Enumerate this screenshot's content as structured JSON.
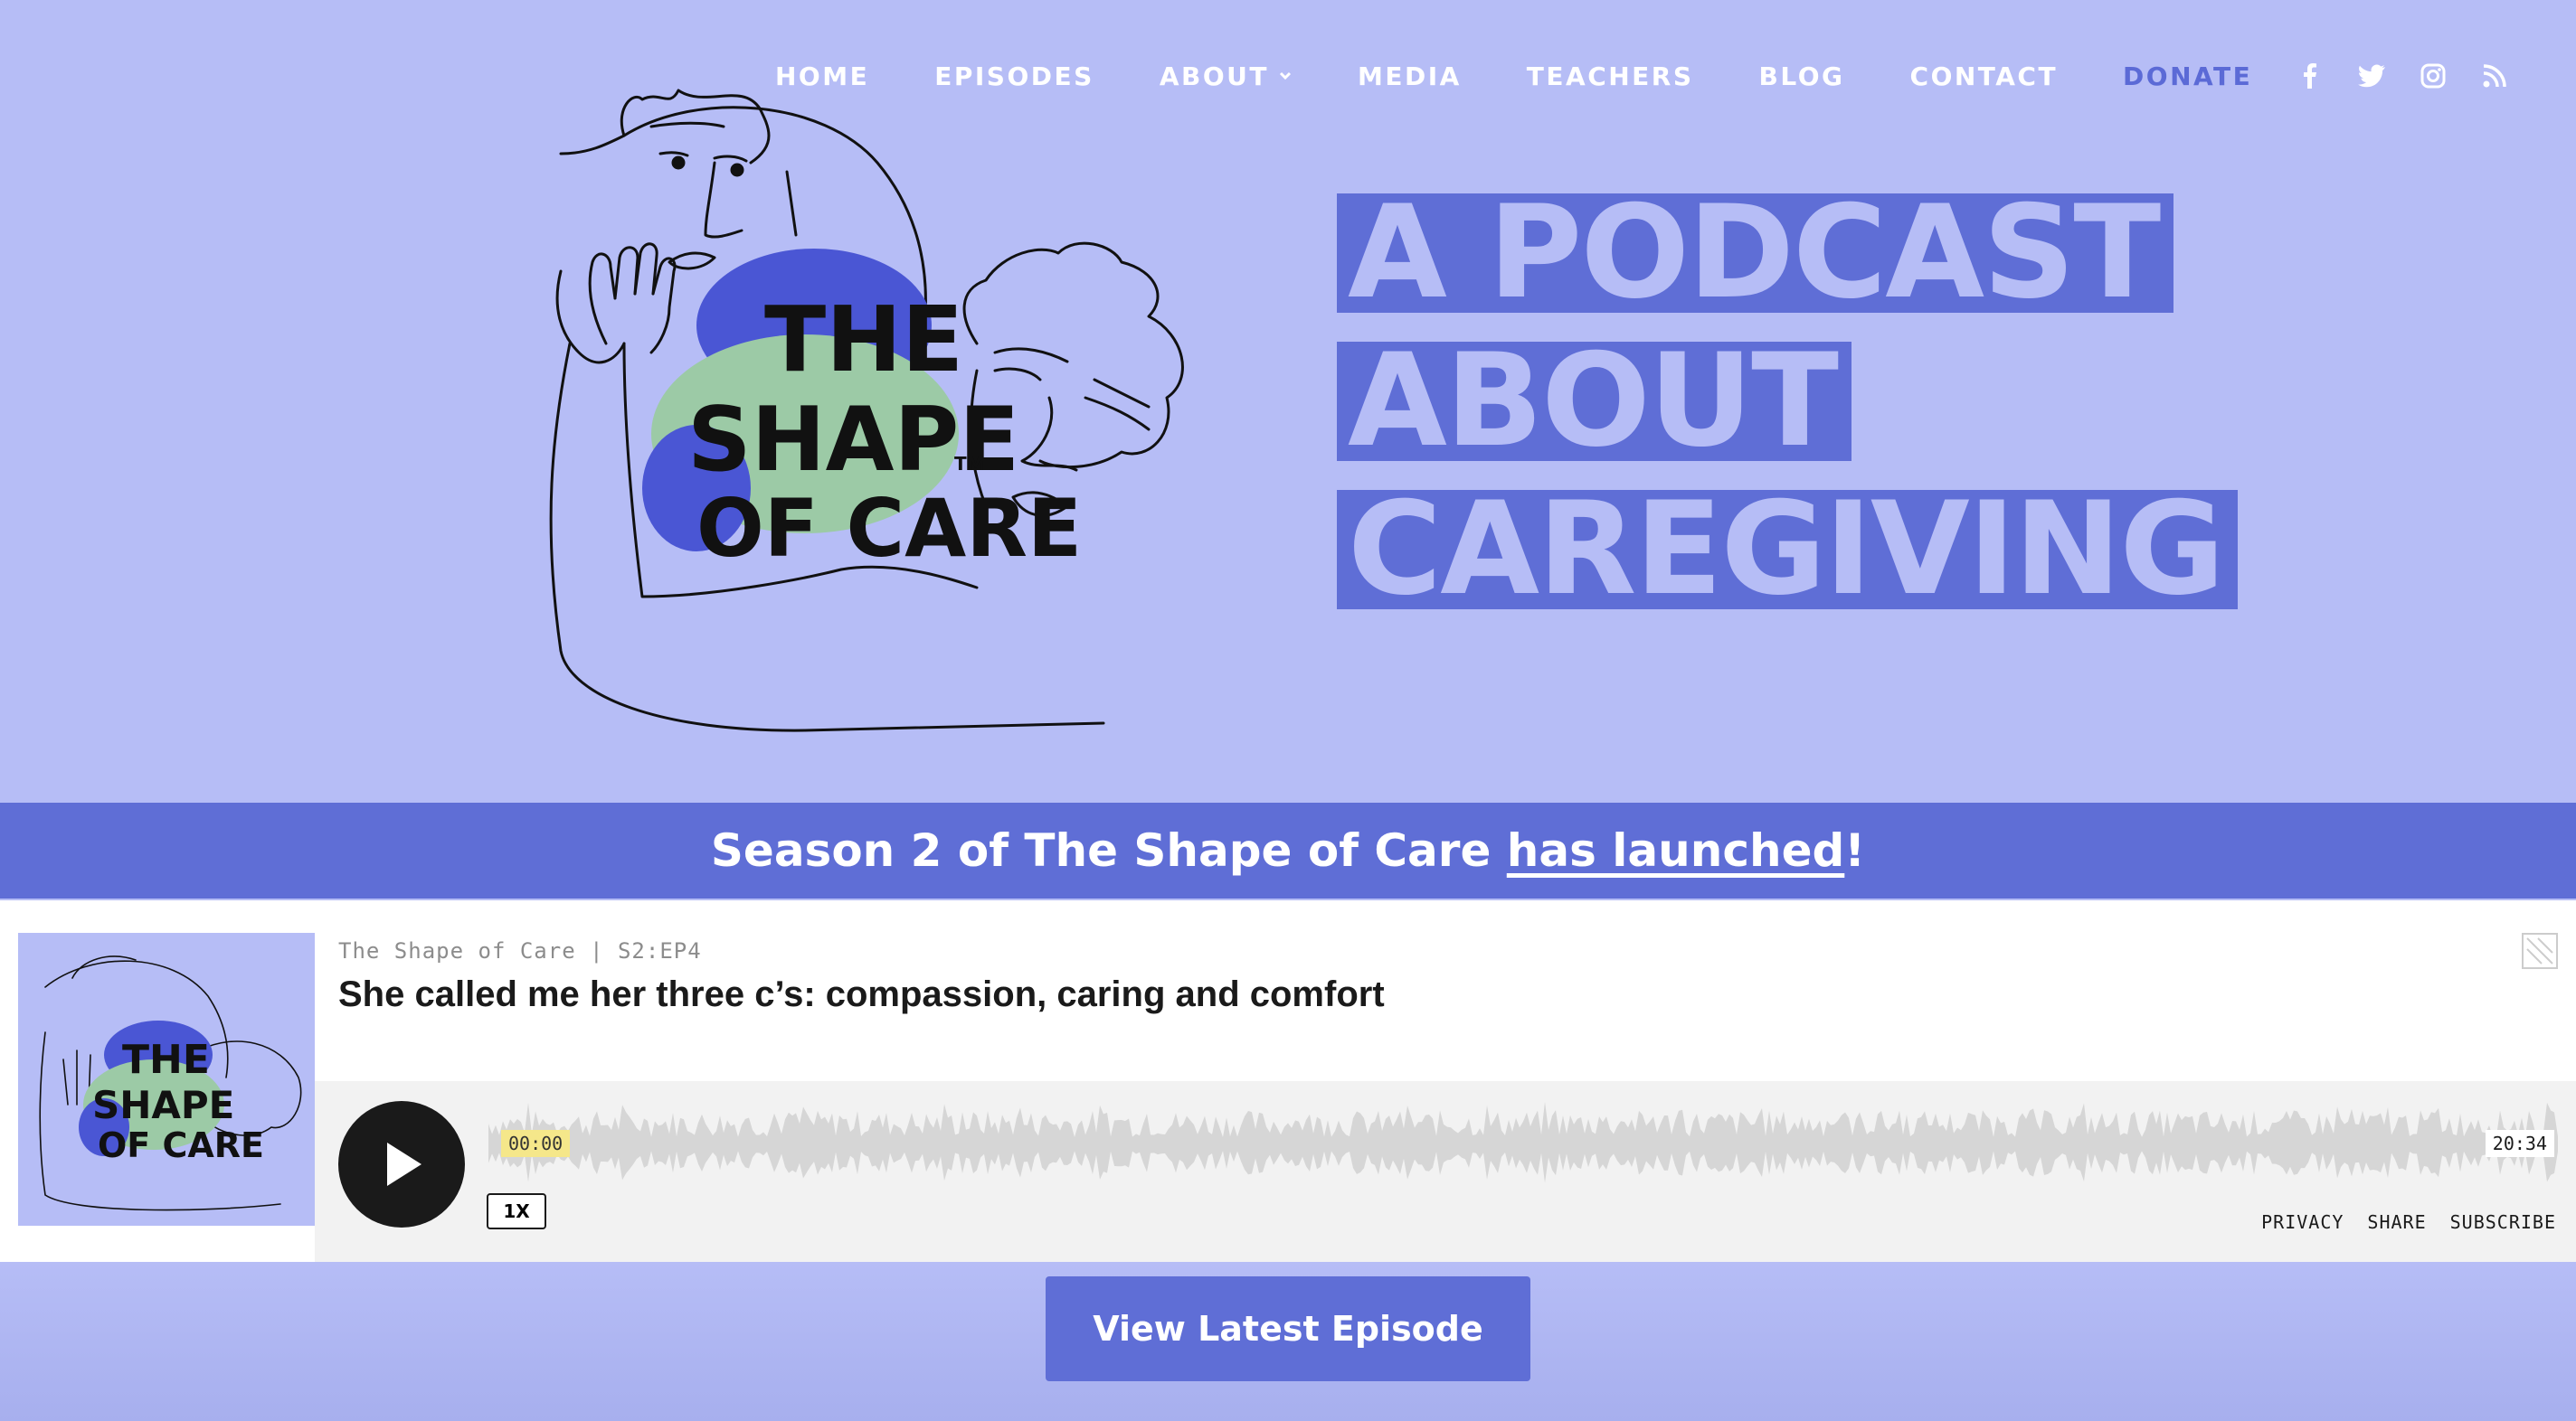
{
  "nav": {
    "items": [
      {
        "label": "HOME"
      },
      {
        "label": "EPISODES"
      },
      {
        "label": "ABOUT"
      },
      {
        "label": "MEDIA"
      },
      {
        "label": "TEACHERS"
      },
      {
        "label": "BLOG"
      },
      {
        "label": "CONTACT"
      }
    ],
    "donate_label": "DONATE",
    "social_icons": [
      "facebook-icon",
      "twitter-icon",
      "instagram-icon",
      "rss-icon"
    ]
  },
  "logo": {
    "text_line1": "THE",
    "text_line2": "SHAPE",
    "text_line3": "OF CARE",
    "tm": "TM"
  },
  "headline": {
    "line1": "A PODCAST",
    "line2": "ABOUT",
    "line3": "CAREGIVING"
  },
  "banner": {
    "prefix": "Season 2 of The Shape of Care ",
    "link_text": "has launched",
    "suffix": "!"
  },
  "player": {
    "cover_text_line1": "THE",
    "cover_text_line2": "SHAPE",
    "cover_text_line3": "OF CARE",
    "show_line": "The Shape of Care | S2:EP4",
    "episode_title": "She called me her three c’s: compassion, caring and comfort",
    "time_current": "00:00",
    "time_total": "20:34",
    "speed": "1X",
    "links": [
      "PRIVACY",
      "SHARE",
      "SUBSCRIBE"
    ]
  },
  "cta": {
    "label": "View Latest Episode"
  },
  "colors": {
    "hero_bg": "#b6bdf6",
    "accent": "#5f6ed6",
    "logo_blue": "#4a56d4",
    "logo_green": "#9ccaa6"
  }
}
